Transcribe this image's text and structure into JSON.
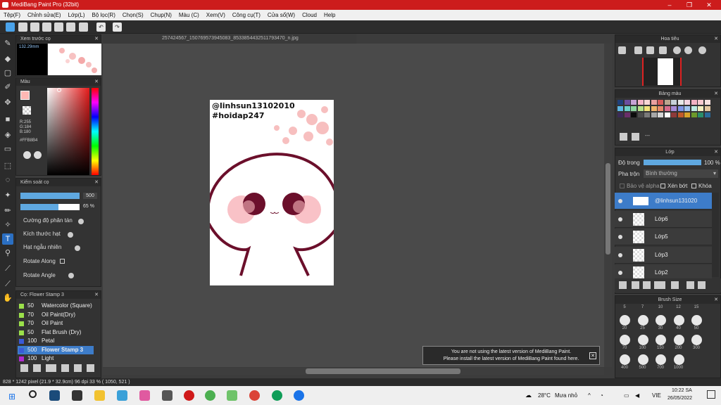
{
  "titlebar": {
    "title": "MediBang Paint Pro (32bit)"
  },
  "menu": [
    "Tệp(F)",
    "Chỉnh sửa(E)",
    "Lớp(L)",
    "Bộ lọc(R)",
    "Chọn(S)",
    "Chụp(N)",
    "Màu (C)",
    "Xem(V)",
    "Công cụ(T)",
    "Cửa sổ(W)",
    "Cloud",
    "Help"
  ],
  "document": {
    "tab": "257424567_150769573945083_8533854432511793470_n.jpg"
  },
  "preview": {
    "title": "Xem trước cọ",
    "size": "132.29mm"
  },
  "color": {
    "title": "Màu",
    "r": "R:255",
    "g": "G:184",
    "b": "B:180",
    "hex": "#FFB8B4",
    "primary": "#ffb8b4"
  },
  "brushctl": {
    "title": "Kiểm soát cọ",
    "size": "500",
    "opacity": "65 %",
    "opts": [
      "Cường độ phân tán",
      "Kích thước hạt",
      "Hạt ngẫu nhiên",
      "Rotate Along",
      "Rotate Angle"
    ]
  },
  "brushes": {
    "title": "Cọ: Flower Stamp 3",
    "items": [
      {
        "n": "50",
        "name": "Watercolor (Square)",
        "c": "#9be04a"
      },
      {
        "n": "70",
        "name": "Oil Paint(Dry)",
        "c": "#9be04a"
      },
      {
        "n": "70",
        "name": "Oil Paint",
        "c": "#9be04a"
      },
      {
        "n": "50",
        "name": "Flat Brush (Dry)",
        "c": "#9be04a"
      },
      {
        "n": "100",
        "name": "Petal",
        "c": "#3a5ad8"
      },
      {
        "n": "500",
        "name": "Flower Stamp 3",
        "c": "#3a5ad8"
      },
      {
        "n": "100",
        "name": "Light",
        "c": "#b02bd0"
      }
    ]
  },
  "artwork": {
    "line1": "@linhsun13102010",
    "line2": "#hoidap247"
  },
  "navigator": {
    "title": "Hoa tiêu"
  },
  "palette": {
    "title": "Bảng màu",
    "label": "---"
  },
  "layers": {
    "title": "Lớp",
    "opacity_label": "Độ trong",
    "opacity": "100 %",
    "blend_label": "Pha trộn",
    "blend": "Bình thường",
    "protect": "Bảo vệ alpha",
    "clip": "Xén bớt",
    "lock": "Khóa",
    "items": [
      "@linhsun131020",
      "Lớp6",
      "Lớp5",
      "Lớp3",
      "Lớp2"
    ]
  },
  "brushsize": {
    "title": "Brush Size",
    "top": [
      "5",
      "7",
      "10",
      "12",
      "15"
    ],
    "rows": [
      [
        "20",
        "25",
        "30",
        "40",
        "50"
      ],
      [
        "70",
        "100",
        "150",
        "200",
        "300"
      ],
      [
        "400",
        "500",
        "700",
        "1000"
      ]
    ]
  },
  "notice": {
    "line1": "You are not using the latest version of MediBang Paint.",
    "line2": "Please install the latest version of MediBang Paint found here."
  },
  "status": {
    "text": "828 * 1242 pixel   (21.9 * 32.9cm)   96 dpi   33 %   ( 1050, 521 )"
  },
  "taskbar": {
    "temp": "28°C",
    "weather": "Mưa nhỏ",
    "lang": "VIE",
    "time": "10:22 SA",
    "date": "26/05/2022"
  }
}
